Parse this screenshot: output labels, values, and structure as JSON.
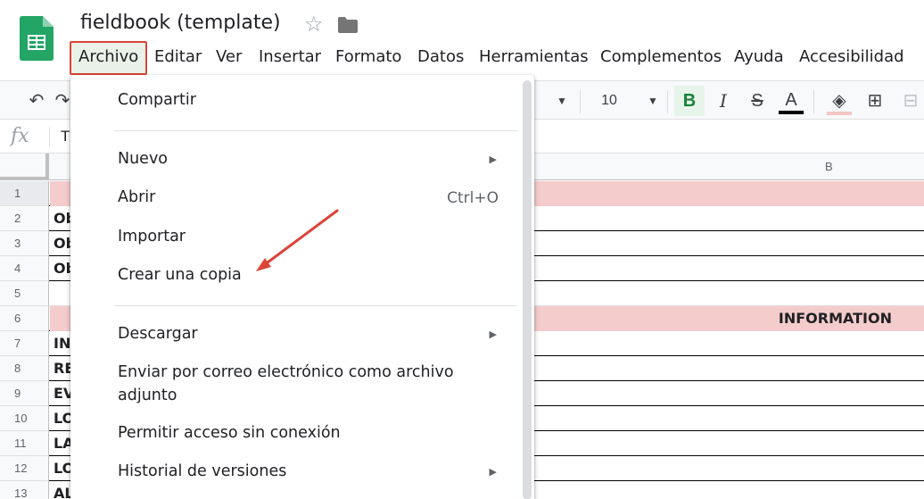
{
  "app": {
    "title": "fieldbook (template)",
    "logo": "sheets-logo-icon"
  },
  "menubar": {
    "items": [
      {
        "label": "Archivo"
      },
      {
        "label": "Editar"
      },
      {
        "label": "Ver"
      },
      {
        "label": "Insertar"
      },
      {
        "label": "Formato"
      },
      {
        "label": "Datos"
      },
      {
        "label": "Herramientas"
      },
      {
        "label": "Complementos"
      },
      {
        "label": "Ayuda"
      },
      {
        "label": "Accesibilidad"
      }
    ]
  },
  "toolbar": {
    "font_size": "10",
    "bold": "B",
    "italic": "I",
    "strike": "S",
    "text_color": "A"
  },
  "formula_bar": {
    "fx": "fx",
    "value": "T"
  },
  "columns": {
    "b": "B"
  },
  "rows": [
    {
      "num": "1",
      "text": ""
    },
    {
      "num": "2",
      "text": "Ob"
    },
    {
      "num": "3",
      "text": "Ob"
    },
    {
      "num": "4",
      "text": "Ob"
    },
    {
      "num": "5",
      "text": ""
    },
    {
      "num": "6",
      "text": ""
    },
    {
      "num": "7",
      "text": "IN"
    },
    {
      "num": "8",
      "text": "RE"
    },
    {
      "num": "9",
      "text": "EV"
    },
    {
      "num": "10",
      "text": "LO"
    },
    {
      "num": "11",
      "text": "LA"
    },
    {
      "num": "12",
      "text": "LO"
    },
    {
      "num": "13",
      "text": "AL"
    }
  ],
  "info_label": "INFORMATION",
  "dropdown": {
    "compartir": "Compartir",
    "nuevo": "Nuevo",
    "abrir": "Abrir",
    "abrir_shortcut": "Ctrl+O",
    "importar": "Importar",
    "crear_copia": "Crear una copia",
    "descargar": "Descargar",
    "enviar_1": "Enviar por correo electrónico como archivo",
    "enviar_2": "adjunto",
    "sin_conexion": "Permitir acceso sin conexión",
    "historial": "Historial de versiones"
  },
  "colors": {
    "accent_green": "#188038",
    "highlight_red": "#db4437",
    "pink_row": "#f4cccc"
  }
}
